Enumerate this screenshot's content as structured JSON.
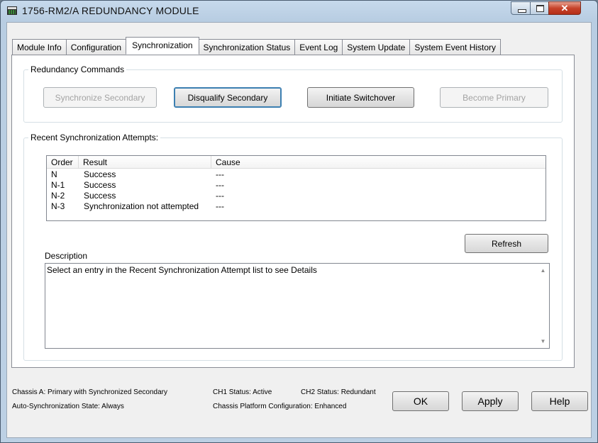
{
  "window": {
    "title": "1756-RM2/A REDUNDANCY MODULE"
  },
  "tabs": [
    {
      "label": "Module Info"
    },
    {
      "label": "Configuration"
    },
    {
      "label": "Synchronization",
      "active": true
    },
    {
      "label": "Synchronization Status"
    },
    {
      "label": "Event Log"
    },
    {
      "label": "System Update"
    },
    {
      "label": "System Event History"
    }
  ],
  "redundancy": {
    "group_label": "Redundancy Commands",
    "synchronize_secondary": "Synchronize Secondary",
    "disqualify_secondary": "Disqualify Secondary",
    "initiate_switchover": "Initiate Switchover",
    "become_primary": "Become Primary"
  },
  "attempts": {
    "group_label": "Recent Synchronization Attempts:",
    "columns": [
      "Order",
      "Result",
      "Cause"
    ],
    "rows": [
      {
        "order": "N",
        "result": "Success",
        "cause": "---"
      },
      {
        "order": "N-1",
        "result": "Success",
        "cause": "---"
      },
      {
        "order": "N-2",
        "result": "Success",
        "cause": "---"
      },
      {
        "order": "N-3",
        "result": "Synchronization not attempted",
        "cause": "---"
      }
    ],
    "refresh_label": "Refresh",
    "description_label": "Description",
    "description_text": "Select an entry in the Recent Synchronization Attempt list to see Details"
  },
  "status": {
    "chassis_a": "Chassis A: Primary with Synchronized Secondary",
    "auto_sync": "Auto-Synchronization State:  Always",
    "ch1": "CH1 Status: Active",
    "ch2": "CH2 Status: Redundant",
    "platform": "Chassis Platform Configuration:  Enhanced"
  },
  "footer": {
    "ok": "OK",
    "apply": "Apply",
    "help": "Help"
  }
}
